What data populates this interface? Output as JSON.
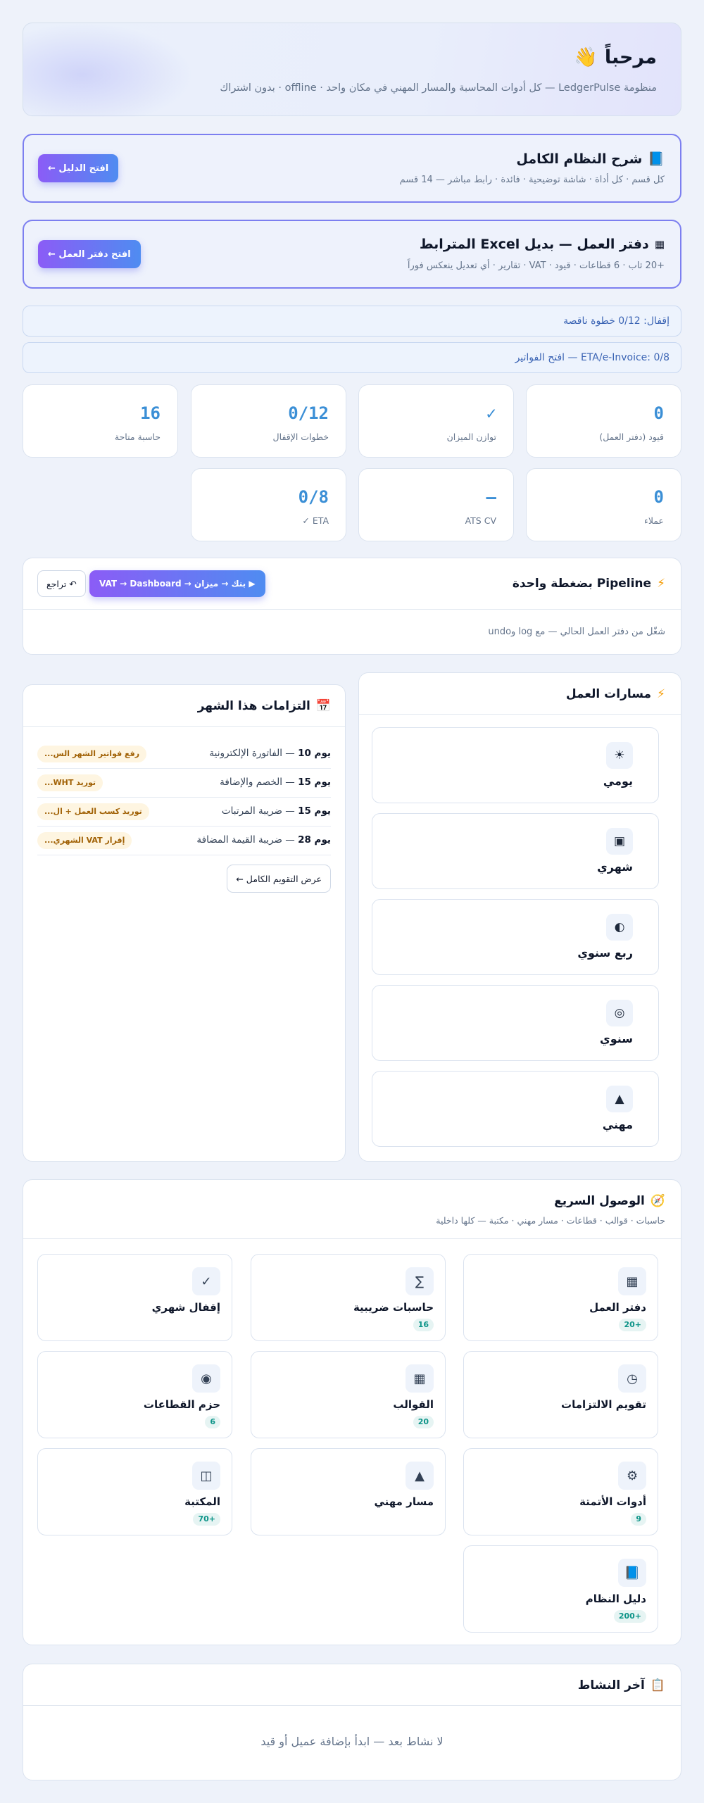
{
  "hero": {
    "title": "مرحباً",
    "emoji": "👋",
    "subtitle": "منظومة LedgerPulse — كل أدوات المحاسبة والمسار المهني في مكان واحد · offline · بدون اشتراك"
  },
  "guide": {
    "icon": "📘",
    "title": "شرح النظام الكامل",
    "subtitle": "كل قسم · كل أداة · شاشة توضيحية · فائدة · رابط مباشر — 14 قسم",
    "button": "افتح الدليل ←"
  },
  "ledger": {
    "icon": "▦",
    "title": "دفتر العمل — بديل Excel المترابط",
    "subtitle": "+20 تاب · 6 قطاعات · قيود · VAT · تقارير · أي تعديل ينعكس فوراً",
    "button": "افتح دفتر العمل ←"
  },
  "notices": {
    "closing": "إقفال: 0/12 خطوة ناقصة",
    "eta": "ETA/e-Invoice: 0/8 — افتح الفواتير"
  },
  "stats": [
    {
      "value": "0",
      "label": "قيود (دفتر العمل)"
    },
    {
      "value": "✓",
      "label": "توازن الميزان"
    },
    {
      "value": "0/12",
      "label": "خطوات الإقفال"
    },
    {
      "value": "16",
      "label": "حاسبة متاحة"
    },
    {
      "value": "0",
      "label": "عملاء"
    },
    {
      "value": "–",
      "label": "ATS CV"
    },
    {
      "value": "0/8",
      "label": "ETA ✓"
    }
  ],
  "pipeline": {
    "icon": "⚡",
    "title": "Pipeline بضغطة واحدة",
    "run_button": "▶ بنك → ميزان → VAT → Dashboard",
    "undo_button": "↶ تراجع",
    "description": "شغّل من دفتر العمل الحالي — مع log وundo"
  },
  "workflows": {
    "icon": "⚡",
    "title": "مسارات العمل",
    "items": [
      {
        "icon": "☀",
        "label": "يومي"
      },
      {
        "icon": "▣",
        "label": "شهري"
      },
      {
        "icon": "◐",
        "label": "ربع سنوي"
      },
      {
        "icon": "◎",
        "label": "سنوي"
      },
      {
        "icon": "▲",
        "label": "مهني"
      }
    ]
  },
  "obligations": {
    "icon": "📅",
    "title": "التزامات هذا الشهر",
    "items": [
      {
        "day": "يوم 10",
        "desc": " — الفاتورة الإلكترونية",
        "tag": "رفع فواتير الشهر الس..."
      },
      {
        "day": "يوم 15",
        "desc": " — الخصم والإضافة",
        "tag": "توريد WHT..."
      },
      {
        "day": "يوم 15",
        "desc": " — ضريبة المرتبات",
        "tag": "توريد كسب العمل + ال..."
      },
      {
        "day": "يوم 28",
        "desc": " — ضريبة القيمة المضافة",
        "tag": "إقرار VAT الشهري..."
      }
    ],
    "calendar_button": "عرض التقويم الكامل ←"
  },
  "quick_access": {
    "icon": "🧭",
    "title": "الوصول السريع",
    "subtitle": "حاسبات · قوالب · قطاعات · مسار مهني · مكتبة — كلها داخلية",
    "items": [
      {
        "icon": "▦",
        "label": "دفتر العمل",
        "badge": "+20"
      },
      {
        "icon": "∑",
        "label": "حاسبات ضريبية",
        "badge": "16"
      },
      {
        "icon": "✓",
        "label": "إقفال شهري",
        "badge": ""
      },
      {
        "icon": "◷",
        "label": "تقويم الالتزامات",
        "badge": ""
      },
      {
        "icon": "▦",
        "label": "القوالب",
        "badge": "20"
      },
      {
        "icon": "◉",
        "label": "حزم القطاعات",
        "badge": "6"
      },
      {
        "icon": "⚙",
        "label": "أدوات الأتمتة",
        "badge": "9"
      },
      {
        "icon": "▲",
        "label": "مسار مهني",
        "badge": ""
      },
      {
        "icon": "◫",
        "label": "المكتبة",
        "badge": "+70"
      },
      {
        "icon": "📘",
        "label": "دليل النظام",
        "badge": "+200"
      }
    ]
  },
  "activity": {
    "icon": "📋",
    "title": "آخر النشاط",
    "empty": "لا نشاط بعد — ابدأ بإضافة عميل أو قيد"
  }
}
